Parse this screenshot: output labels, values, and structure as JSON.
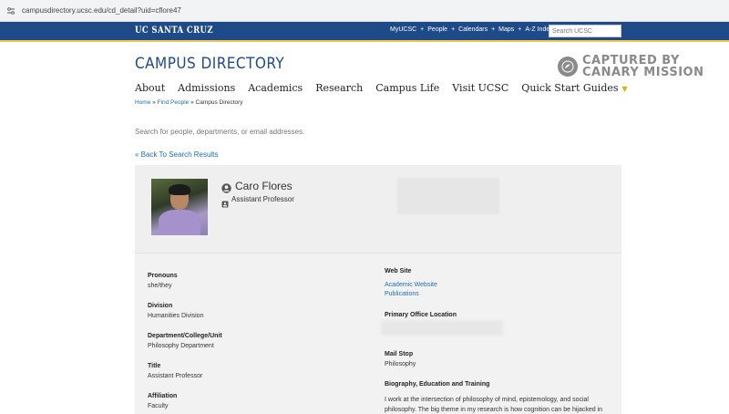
{
  "browser": {
    "url": "campusdirectory.ucsc.edu/cd_detail?uid=cflore47"
  },
  "topbar": {
    "brand": "UC SANTA CRUZ",
    "links": [
      "MyUCSC",
      "People",
      "Calendars",
      "Maps",
      "A-Z Index"
    ],
    "separator": "+",
    "search_placeholder": "Search UCSC"
  },
  "header": {
    "site_title": "CAMPUS DIRECTORY",
    "watermark_line1": "CAPTURED BY",
    "watermark_line2": "CANARY MISSION"
  },
  "nav": {
    "items": [
      "About",
      "Admissions",
      "Academics",
      "Research",
      "Campus Life",
      "Visit UCSC",
      "Quick Start Guides"
    ]
  },
  "breadcrumb": {
    "home": "Home",
    "sep": "»",
    "find_people": "Find People",
    "current": "Campus Directory"
  },
  "search": {
    "placeholder": "Search for people, departments, or email addresses."
  },
  "back_link": "« Back To Search Results",
  "profile": {
    "name": "Caro Flores",
    "title": "Assistant Professor"
  },
  "fields_left": [
    {
      "label": "Pronouns",
      "value": "she/they"
    },
    {
      "label": "Division",
      "value": "Humanities Division"
    },
    {
      "label": "Department/College/Unit",
      "value": "Philosophy Department"
    },
    {
      "label": "Title",
      "value": "Assistant Professor"
    },
    {
      "label": "Affiliation",
      "value": "Faculty"
    }
  ],
  "fields_right": {
    "website_label": "Web Site",
    "website_links": [
      "Academic Website",
      "Publications"
    ],
    "office_label": "Primary Office Location",
    "mailstop_label": "Mail Stop",
    "mailstop_value": "Philosophy",
    "bio_label": "Biography, Education and Training",
    "bio_text": "I work at the intersection of philosophy of mind, epistemology, and social philosophy. The big theme in my research is how cognition can be hijacked in"
  },
  "colors": {
    "ucsc_blue": "#1e4b87",
    "gold": "#f2c94c",
    "link": "#1e6fb8"
  }
}
